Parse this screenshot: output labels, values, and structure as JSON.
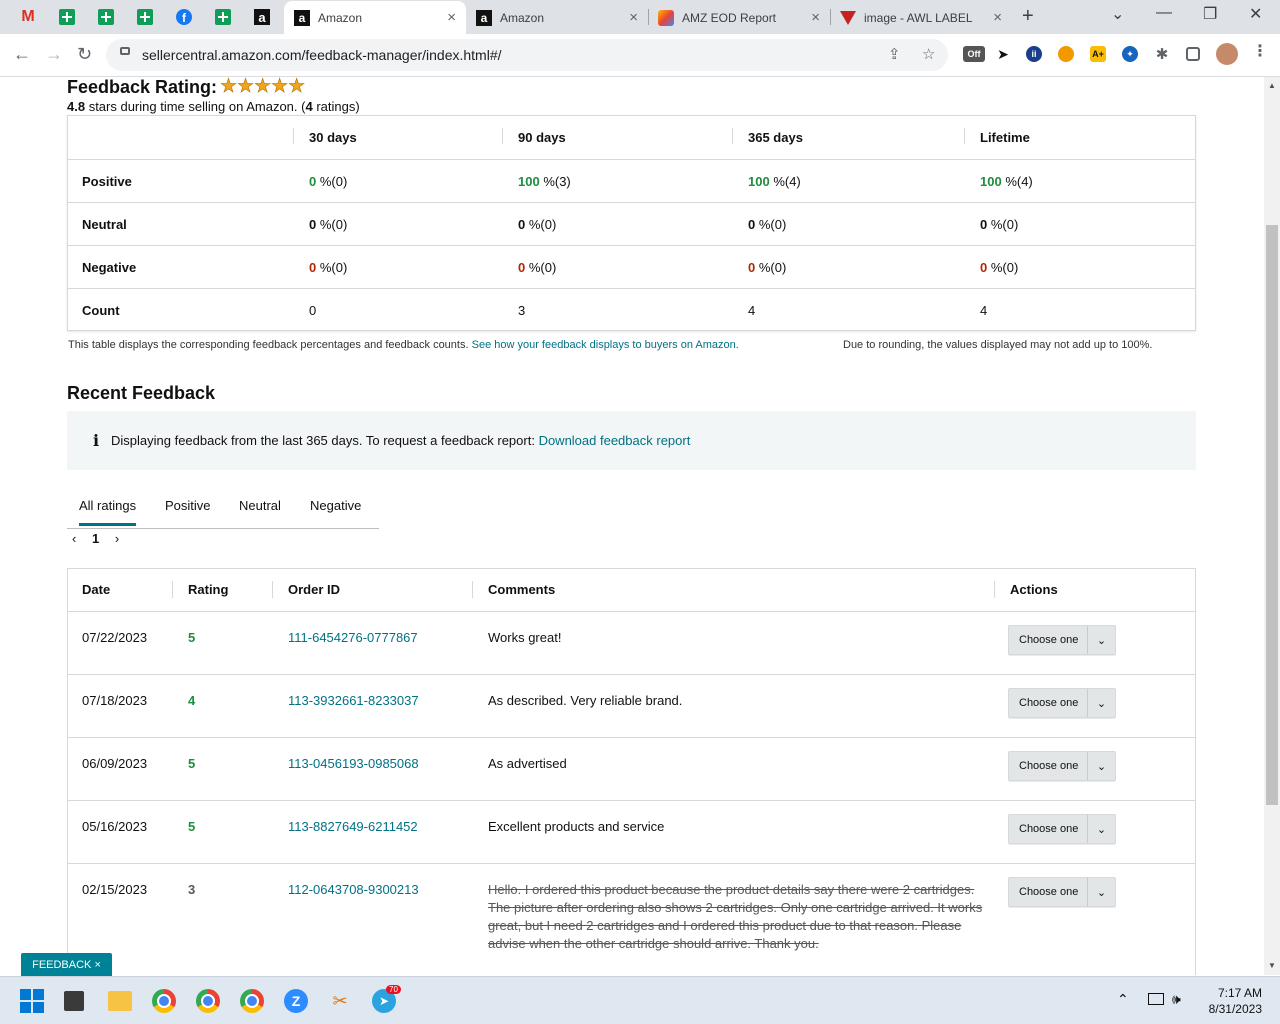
{
  "browser": {
    "tabs": [
      {
        "title": "Amazon",
        "close": "×"
      },
      {
        "title": "Amazon",
        "close": "×"
      },
      {
        "title": "AMZ EOD Report",
        "close": "×"
      },
      {
        "title": "image - AWL LABEL",
        "close": "×"
      }
    ],
    "pinned_icons": [
      "gmail-icon",
      "sheets-icon",
      "sheets-icon",
      "sheets-icon",
      "facebook-icon",
      "sheets-icon",
      "amazon-icon"
    ],
    "new_tab": "+",
    "url": "sellercentral.amazon.com/feedback-manager/index.html#/",
    "ext_off_label": "Off",
    "window_controls": {
      "minimize": "—",
      "maximize": "❐",
      "close": "✕",
      "tab_search": "⌄"
    }
  },
  "rating": {
    "title": "Feedback Rating:",
    "stars": "★★★★★",
    "score": "4.8",
    "sub_middle": " stars during time selling on Amazon. (",
    "count": "4",
    "sub_end": " ratings)"
  },
  "summary": {
    "headers": [
      "30 days",
      "90 days",
      "365 days",
      "Lifetime"
    ],
    "rows": [
      {
        "label": "Positive",
        "cells": [
          {
            "num": "0",
            "rest": " %(0)"
          },
          {
            "num": "100",
            "rest": " %(3)"
          },
          {
            "num": "100",
            "rest": " %(4)"
          },
          {
            "num": "100",
            "rest": " %(4)"
          }
        ]
      },
      {
        "label": "Neutral",
        "cells": [
          {
            "num": "0",
            "rest": " %(0)"
          },
          {
            "num": "0",
            "rest": " %(0)"
          },
          {
            "num": "0",
            "rest": " %(0)"
          },
          {
            "num": "0",
            "rest": " %(0)"
          }
        ]
      },
      {
        "label": "Negative",
        "cells": [
          {
            "num": "0",
            "rest": " %(0)"
          },
          {
            "num": "0",
            "rest": " %(0)"
          },
          {
            "num": "0",
            "rest": " %(0)"
          },
          {
            "num": "0",
            "rest": " %(0)"
          }
        ]
      },
      {
        "label": "Count",
        "cells": [
          {
            "num": "0",
            "rest": ""
          },
          {
            "num": "3",
            "rest": ""
          },
          {
            "num": "4",
            "rest": ""
          },
          {
            "num": "4",
            "rest": ""
          }
        ]
      }
    ],
    "note": "This table displays the corresponding feedback percentages and feedback counts.",
    "note_link": "See how your feedback displays to buyers on Amazon.",
    "rounding": "Due to rounding, the values displayed may not add up to 100%."
  },
  "recent": {
    "title": "Recent Feedback",
    "info_icon": "i",
    "info_text": "Displaying feedback from the last 365 days. To request a feedback report: ",
    "info_link": "Download feedback report",
    "filter_tabs": [
      "All ratings",
      "Positive",
      "Neutral",
      "Negative"
    ],
    "pager": {
      "prev": "‹",
      "page": "1",
      "next": "›"
    },
    "columns": [
      "Date",
      "Rating",
      "Order ID",
      "Comments",
      "Actions"
    ],
    "rows": [
      {
        "date": "07/22/2023",
        "rating": "5",
        "order_id": "111-6454276-0777867",
        "comment": "Works great!",
        "action": "Choose one"
      },
      {
        "date": "07/18/2023",
        "rating": "4",
        "order_id": "113-3932661-8233037",
        "comment": "As described. Very reliable brand.",
        "action": "Choose one"
      },
      {
        "date": "06/09/2023",
        "rating": "5",
        "order_id": "113-0456193-0985068",
        "comment": "As advertised",
        "action": "Choose one"
      },
      {
        "date": "05/16/2023",
        "rating": "5",
        "order_id": "113-8827649-6211452",
        "comment": "Excellent products and service",
        "action": "Choose one"
      },
      {
        "date": "02/15/2023",
        "rating": "3",
        "order_id": "112-0643708-9300213",
        "comment": "Hello. I ordered this product because the product details say there were 2 cartridges. The picture after ordering also shows 2 cartridges. Only one cartridge arrived. It works great, but I need 2 cartridges and I ordered this product due to that reason. Please advise when the other cartridge should arrive. Thank you.",
        "action": "Choose one"
      }
    ],
    "dropdown_arrow": "⌄"
  },
  "feedback_button": {
    "label": "FEEDBACK",
    "close": "×"
  },
  "taskbar": {
    "time": "7:17 AM",
    "date": "8/31/2023",
    "telegram_badge": "70",
    "tray_chevron": "⌃"
  },
  "colors": {
    "link": "#007185",
    "positive": "#1e8e3e",
    "negative": "#b12704",
    "star": "#f0a51e",
    "feedback_btn": "#008296"
  }
}
